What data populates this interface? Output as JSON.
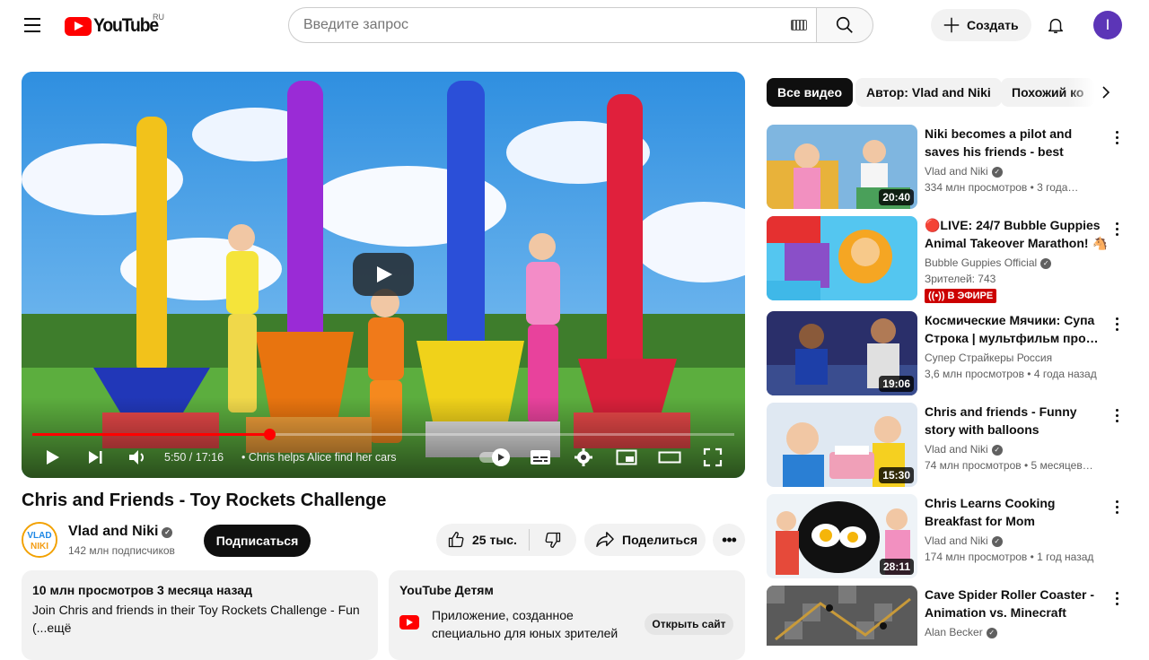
{
  "header": {
    "logo_text": "YouTube",
    "country": "RU",
    "search_placeholder": "Введите запрос",
    "create_label": "Создать",
    "avatar_letter": "I"
  },
  "player": {
    "time": "5:50 / 17:16",
    "chapter": "• Chris helps Alice find her cars",
    "progress_fraction": 0.338
  },
  "video": {
    "title": "Chris and Friends - Toy Rockets Challenge",
    "channel": "Vlad and Niki",
    "subscribers": "142 млн подписчиков",
    "subscribe_label": "Подписаться",
    "likes": "25 тыс.",
    "share_label": "Поделиться",
    "more_label": "•••"
  },
  "description": {
    "meta": "10 млн просмотров  3 месяца назад",
    "text": "Join Chris and friends in their Toy Rockets Challenge - Fun (...ещё"
  },
  "kids_panel": {
    "title": "YouTube Детям",
    "text": "Приложение, созданное специально для юных зрителей",
    "button": "Открыть сайт"
  },
  "chips": [
    "Все видео",
    "Автор: Vlad and Niki",
    "Похожий ко"
  ],
  "recommendations": [
    {
      "title": "Niki becomes a pilot and saves his friends - best stories for kids",
      "channel": "Vlad and Niki",
      "verified": true,
      "meta": "334 млн просмотров  • 3 года…",
      "duration": "20:40",
      "live": false
    },
    {
      "title": "🔴LIVE: 24/7 Bubble Guppies Animal Takeover Marathon! 🐴",
      "channel": "Bubble Guppies Official",
      "verified": true,
      "meta": "Зрителей: 743",
      "duration": "",
      "live": true,
      "live_label": "((•)) В ЭФИРЕ"
    },
    {
      "title": "Космические Мячики: Супа Строка | мультфильм про…",
      "channel": "Супер Страйкеры Россия",
      "verified": false,
      "meta": "3,6 млн просмотров  • 4 года назад",
      "duration": "19:06",
      "live": false
    },
    {
      "title": "Chris and friends - Funny story with balloons",
      "channel": "Vlad and Niki",
      "verified": true,
      "meta": "74 млн просмотров  • 5 месяцев…",
      "duration": "15:30",
      "live": false
    },
    {
      "title": "Chris Learns Cooking Breakfast for Mom",
      "channel": "Vlad and Niki",
      "verified": true,
      "meta": "174 млн просмотров  • 1 год назад",
      "duration": "28:11",
      "live": false
    },
    {
      "title": "Cave Spider Roller Coaster - Animation vs. Minecraft Short…",
      "channel": "Alan Becker",
      "verified": true,
      "meta": "",
      "duration": "",
      "live": false
    }
  ],
  "colors": {
    "brand_red": "#ff0000",
    "avatar_bg": "#5c35b7",
    "live_red": "#cc0000"
  }
}
